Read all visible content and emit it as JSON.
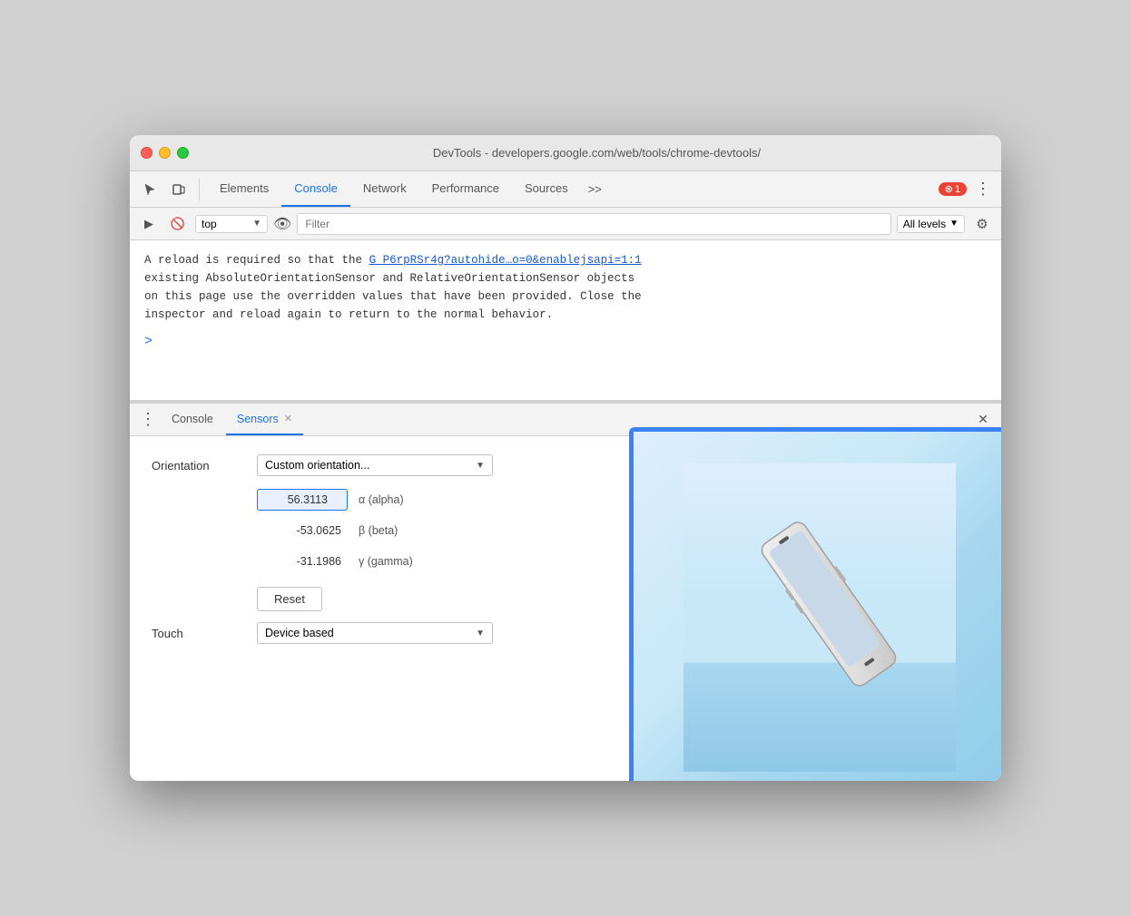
{
  "window": {
    "title": "DevTools - developers.google.com/web/tools/chrome-devtools/"
  },
  "toolbar": {
    "tabs": [
      "Elements",
      "Console",
      "Network",
      "Performance",
      "Sources"
    ],
    "active_tab": "Console",
    "more_label": ">>",
    "error_count": "1",
    "menu_label": "⋮"
  },
  "filter_bar": {
    "context_value": "top",
    "filter_placeholder": "Filter",
    "level_label": "All levels",
    "eye_icon": "👁"
  },
  "console": {
    "message": "A reload is required so that the",
    "link_text": "G_P6rpRSr4g?autohide…o=0&enablejsapi=1:1",
    "message2": "existing AbsoluteOrientationSensor and RelativeOrientationSensor objects",
    "message3": "on this page use the overridden values that have been provided. Close the",
    "message4": "inspector and reload again to return to the normal behavior.",
    "prompt": ">"
  },
  "bottom_panel": {
    "tabs": [
      "Console",
      "Sensors"
    ],
    "active_tab": "Sensors",
    "close_label": "✕"
  },
  "sensors": {
    "orientation_label": "Orientation",
    "dropdown_value": "Custom orientation...",
    "alpha_value": "56.3113",
    "alpha_label": "α (alpha)",
    "beta_value": "-53.0625",
    "beta_label": "β (beta)",
    "gamma_value": "-31.1986",
    "gamma_label": "γ (gamma)",
    "reset_label": "Reset",
    "touch_label": "Touch",
    "touch_dropdown": "Device based"
  }
}
